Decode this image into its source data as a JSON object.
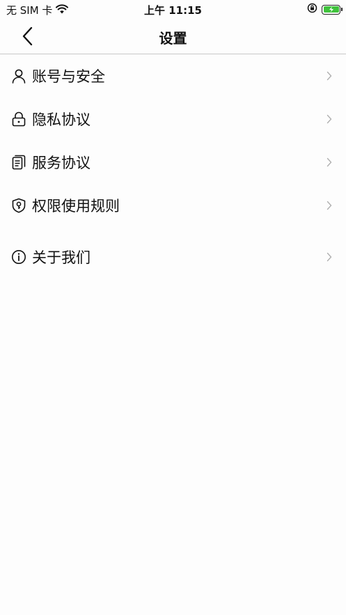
{
  "status": {
    "carrier": "无 SIM 卡",
    "time": "上午 11:15"
  },
  "nav": {
    "title": "设置"
  },
  "menu": {
    "items": [
      {
        "label": "账号与安全",
        "icon": "person-icon"
      },
      {
        "label": "隐私协议",
        "icon": "lock-icon"
      },
      {
        "label": "服务协议",
        "icon": "document-icon"
      },
      {
        "label": "权限使用规则",
        "icon": "shield-key-icon"
      },
      {
        "label": "关于我们",
        "icon": "info-icon"
      }
    ]
  },
  "colors": {
    "battery": "#3fc23c",
    "chevron": "#b0b0b0",
    "divider": "#c8c8c8"
  }
}
